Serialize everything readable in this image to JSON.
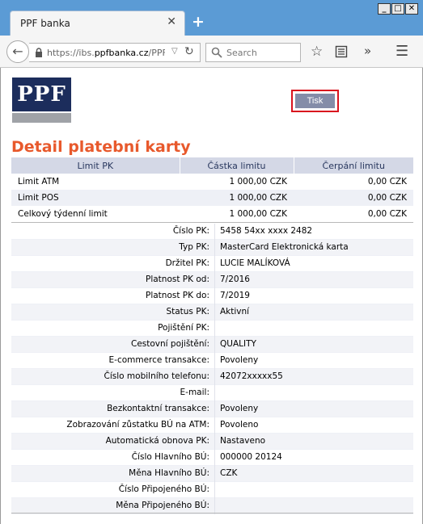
{
  "browser": {
    "tab_title": "PPF banka",
    "tab_close": "✕",
    "new_tab": "+",
    "url_scheme": "https://ibs.",
    "url_host": "ppfbanka.cz",
    "url_path": "/PPFIE",
    "search_placeholder": "Search"
  },
  "header": {
    "logo_text": "PPF",
    "print_label": "Tisk"
  },
  "page_title": "Detail platební karty",
  "limits": {
    "columns": [
      "Limit PK",
      "Částka limitu",
      "Čerpání limitu"
    ],
    "rows": [
      {
        "name": "Limit ATM",
        "amount": "1 000,00 CZK",
        "used": "0,00 CZK"
      },
      {
        "name": "Limit POS",
        "amount": "1 000,00 CZK",
        "used": "0,00 CZK"
      },
      {
        "name": "Celkový týdenní limit",
        "amount": "1 000,00 CZK",
        "used": "0,00 CZK"
      }
    ]
  },
  "details": [
    {
      "label": "Číslo PK:",
      "value": "5458 54xx xxxx 2482"
    },
    {
      "label": "Typ PK:",
      "value": "MasterCard Elektronická karta"
    },
    {
      "label": "Držitel PK:",
      "value": "LUCIE MALÍKOVÁ"
    },
    {
      "label": "Platnost PK od:",
      "value": "7/2016"
    },
    {
      "label": "Platnost PK do:",
      "value": "7/2019"
    },
    {
      "label": "Status PK:",
      "value": "Aktivní"
    },
    {
      "label": "Pojištění PK:",
      "value": ""
    },
    {
      "label": "Cestovní pojištění:",
      "value": "QUALITY"
    },
    {
      "label": "E-commerce transakce:",
      "value": "Povoleny"
    },
    {
      "label": "Číslo mobilního telefonu:",
      "value": "42072xxxxx55"
    },
    {
      "label": "E-mail:",
      "value": ""
    },
    {
      "label": "Bezkontaktní transakce:",
      "value": "Povoleny"
    },
    {
      "label": "Zobrazování zůstatku BÚ na ATM:",
      "value": "Povoleno"
    },
    {
      "label": "Automatická obnova PK:",
      "value": "Nastaveno"
    },
    {
      "label": "Číslo Hlavního BÚ:",
      "value": "000000 20124"
    },
    {
      "label": "Měna Hlavního BÚ:",
      "value": "CZK"
    },
    {
      "label": "Číslo Připojeného BÚ:",
      "value": ""
    },
    {
      "label": "Měna Připojeného BÚ:",
      "value": ""
    }
  ]
}
